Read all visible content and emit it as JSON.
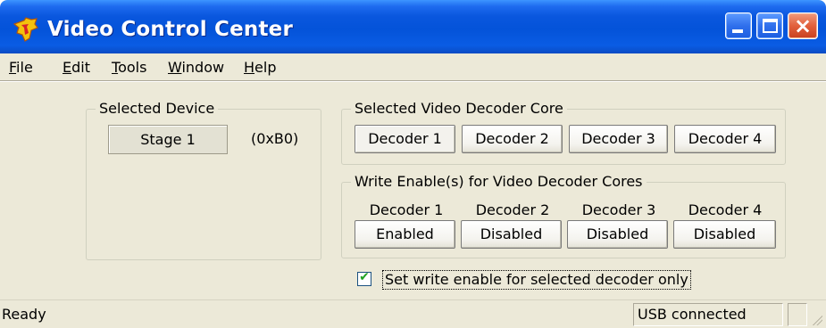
{
  "window": {
    "title": "Video Control Center",
    "icon": "ti-logo-icon"
  },
  "title_buttons": {
    "minimize": "minimize",
    "maximize": "maximize",
    "close": "×"
  },
  "menu": {
    "items": [
      {
        "label": "File",
        "accel": "F",
        "rest": "ile"
      },
      {
        "label": "Edit",
        "accel": "E",
        "rest": "dit"
      },
      {
        "label": "Tools",
        "accel": "T",
        "rest": "ools"
      },
      {
        "label": "Window",
        "accel": "W",
        "rest": "indow"
      },
      {
        "label": "Help",
        "accel": "H",
        "rest": "elp"
      }
    ]
  },
  "selected_device": {
    "group_title": "Selected Device",
    "device_name": "Stage 1",
    "address": "(0xB0)"
  },
  "decoder_core": {
    "group_title": "Selected Video Decoder Core",
    "buttons": [
      {
        "label": "Decoder  1",
        "selected": true
      },
      {
        "label": "Decoder 2",
        "selected": false
      },
      {
        "label": "Decoder 3",
        "selected": false
      },
      {
        "label": "Decoder  4",
        "selected": false
      }
    ]
  },
  "write_enable": {
    "group_title": "Write Enable(s) for Video Decoder Cores",
    "columns": [
      {
        "label": "Decoder 1",
        "state": "Enabled"
      },
      {
        "label": "Decoder 2",
        "state": "Disabled"
      },
      {
        "label": "Decoder 3",
        "state": "Disabled"
      },
      {
        "label": "Decoder 4",
        "state": "Disabled"
      }
    ]
  },
  "options": {
    "selected_only_label": "Set write enable for selected decoder only",
    "selected_only_checked": true,
    "check_glyph": "✔"
  },
  "status": {
    "ready": "Ready",
    "connection": "USB connected"
  },
  "colors": {
    "titlebar": "#0453d9",
    "face": "#ece9d8",
    "checkmark": "#21a121"
  }
}
